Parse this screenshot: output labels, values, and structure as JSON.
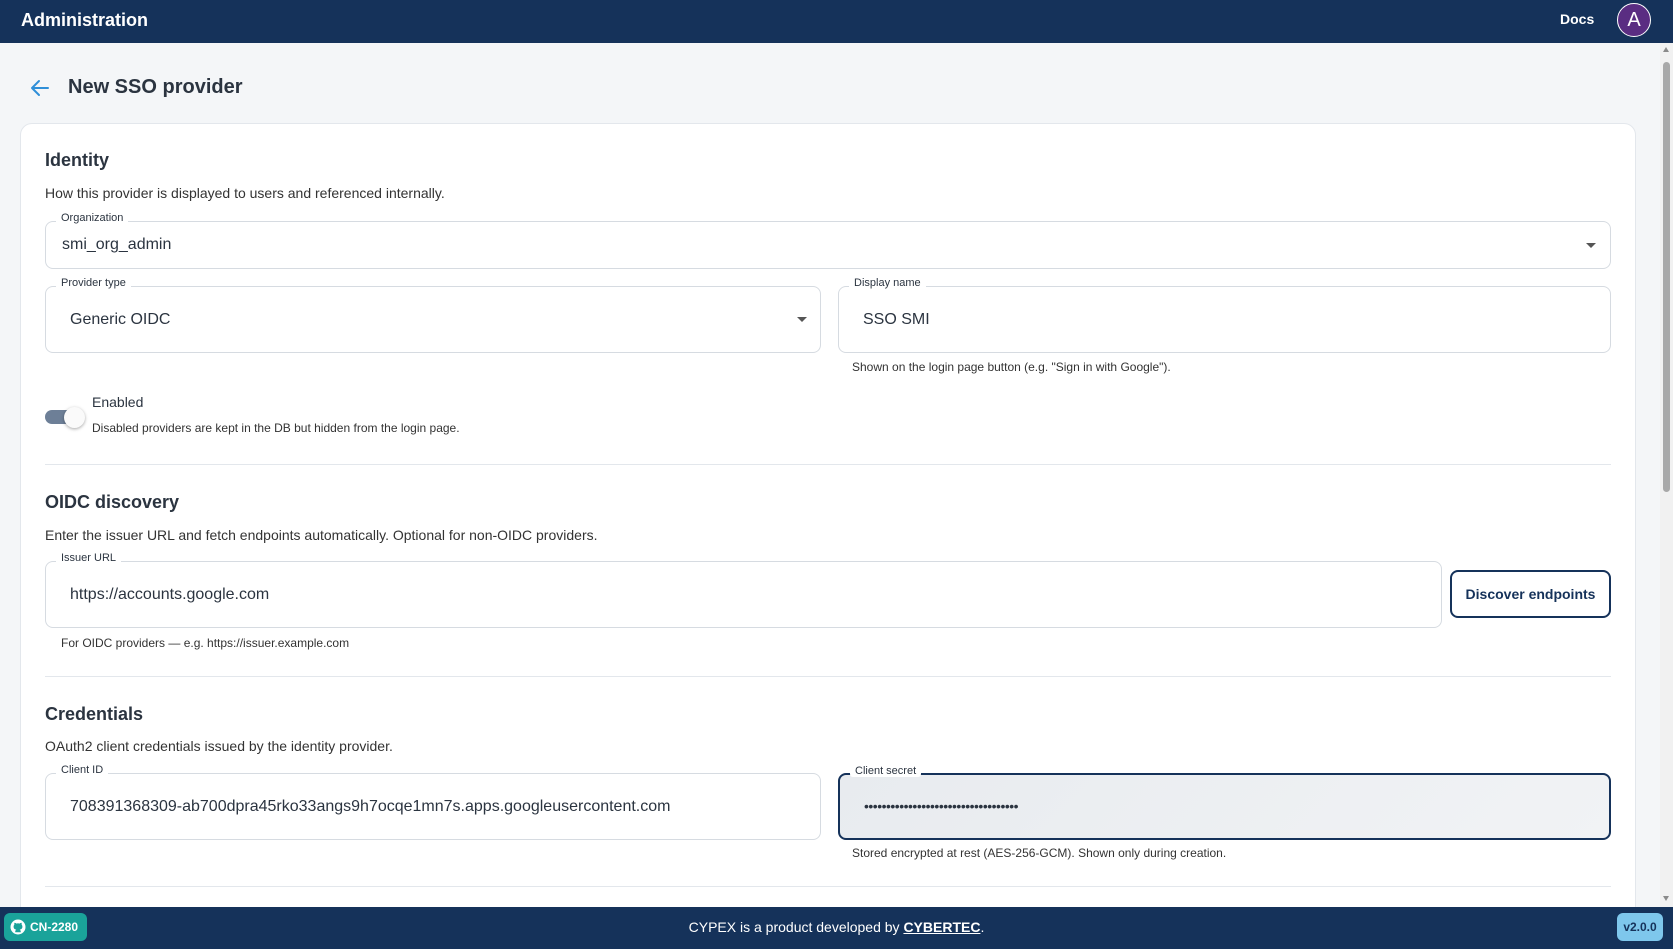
{
  "topbar": {
    "title": "Administration",
    "docs_label": "Docs",
    "avatar_initial": "A"
  },
  "page": {
    "title": "New SSO provider"
  },
  "identity": {
    "title": "Identity",
    "description": "How this provider is displayed to users and referenced internally.",
    "organization": {
      "label": "Organization",
      "value": "smi_org_admin"
    },
    "provider_type": {
      "label": "Provider type",
      "value": "Generic OIDC"
    },
    "display_name": {
      "label": "Display name",
      "value": "SSO SMI",
      "helper": "Shown on the login page button (e.g. \"Sign in with Google\")."
    },
    "enabled": {
      "label": "Enabled",
      "helper": "Disabled providers are kept in the DB but hidden from the login page.",
      "checked": true
    }
  },
  "oidc": {
    "title": "OIDC discovery",
    "description": "Enter the issuer URL and fetch endpoints automatically. Optional for non-OIDC providers.",
    "issuer_url": {
      "label": "Issuer URL",
      "value": "https://accounts.google.com",
      "helper": "For OIDC providers — e.g. https://issuer.example.com"
    },
    "discover_button": "Discover endpoints"
  },
  "credentials": {
    "title": "Credentials",
    "description": "OAuth2 client credentials issued by the identity provider.",
    "client_id": {
      "label": "Client ID",
      "value": "708391368309-ab700dpra45rko33angs9h7ocqe1mn7s.apps.googleusercontent.com"
    },
    "client_secret": {
      "label": "Client secret",
      "value": "•••••••••••••••••••••••••••••••••••",
      "helper": "Stored encrypted at rest (AES-256-GCM). Shown only during creation."
    }
  },
  "footer": {
    "badge": "CN-2280",
    "credit_prefix": "CYPEX is a product developed by ",
    "credit_link": "CYBERTEC",
    "credit_suffix": ".",
    "version": "v2.0.0"
  }
}
